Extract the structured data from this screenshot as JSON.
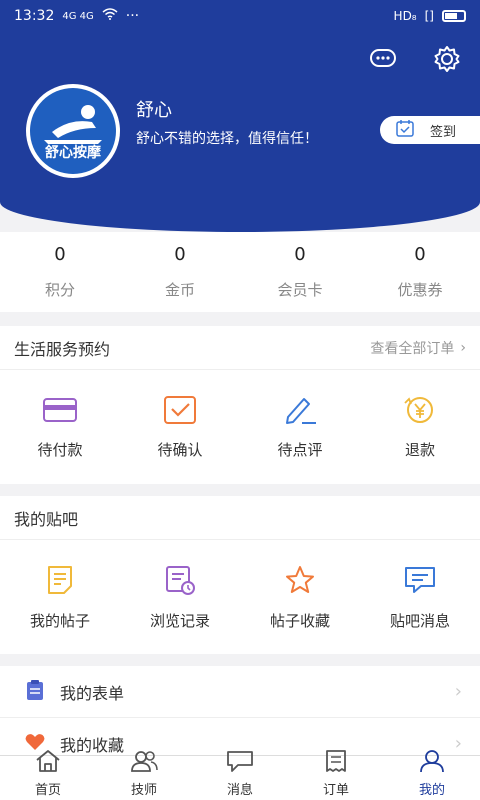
{
  "status": {
    "time": "13:32",
    "signal": "4G 4G",
    "dots": "···",
    "network": "HD₈",
    "vibrate": "[]"
  },
  "profile": {
    "name": "舒心",
    "motto": "舒心不错的选择，值得信任！",
    "logo_text": "舒心按摩",
    "checkin": "签到"
  },
  "stats": [
    {
      "value": "0",
      "label": "积分"
    },
    {
      "value": "0",
      "label": "金币"
    },
    {
      "value": "0",
      "label": "会员卡"
    },
    {
      "value": "0",
      "label": "优惠券"
    }
  ],
  "service": {
    "title": "生活服务预约",
    "more": "查看全部订单",
    "items": [
      {
        "label": "待付款",
        "icon": "card-icon"
      },
      {
        "label": "待确认",
        "icon": "check-box-icon"
      },
      {
        "label": "待点评",
        "icon": "pen-icon"
      },
      {
        "label": "退款",
        "icon": "yen-coin-icon"
      }
    ]
  },
  "forum": {
    "title": "我的贴吧",
    "items": [
      {
        "label": "我的帖子",
        "icon": "note-icon"
      },
      {
        "label": "浏览记录",
        "icon": "history-icon"
      },
      {
        "label": "帖子收藏",
        "icon": "star-icon"
      },
      {
        "label": "贴吧消息",
        "icon": "message-icon"
      }
    ]
  },
  "list": [
    {
      "label": "我的表单",
      "icon": "clipboard-icon"
    },
    {
      "label": "我的收藏",
      "icon": "heart-icon"
    }
  ],
  "tabs": [
    {
      "label": "首页",
      "icon": "home-icon"
    },
    {
      "label": "技师",
      "icon": "users-icon"
    },
    {
      "label": "消息",
      "icon": "chat-icon"
    },
    {
      "label": "订单",
      "icon": "receipt-icon"
    },
    {
      "label": "我的",
      "icon": "person-icon",
      "active": true
    }
  ],
  "colors": {
    "primary": "#1f3d9c",
    "purple": "#9a63c9",
    "orange": "#f07a3a",
    "blue": "#3a79d8",
    "gold": "#f0b93a"
  }
}
